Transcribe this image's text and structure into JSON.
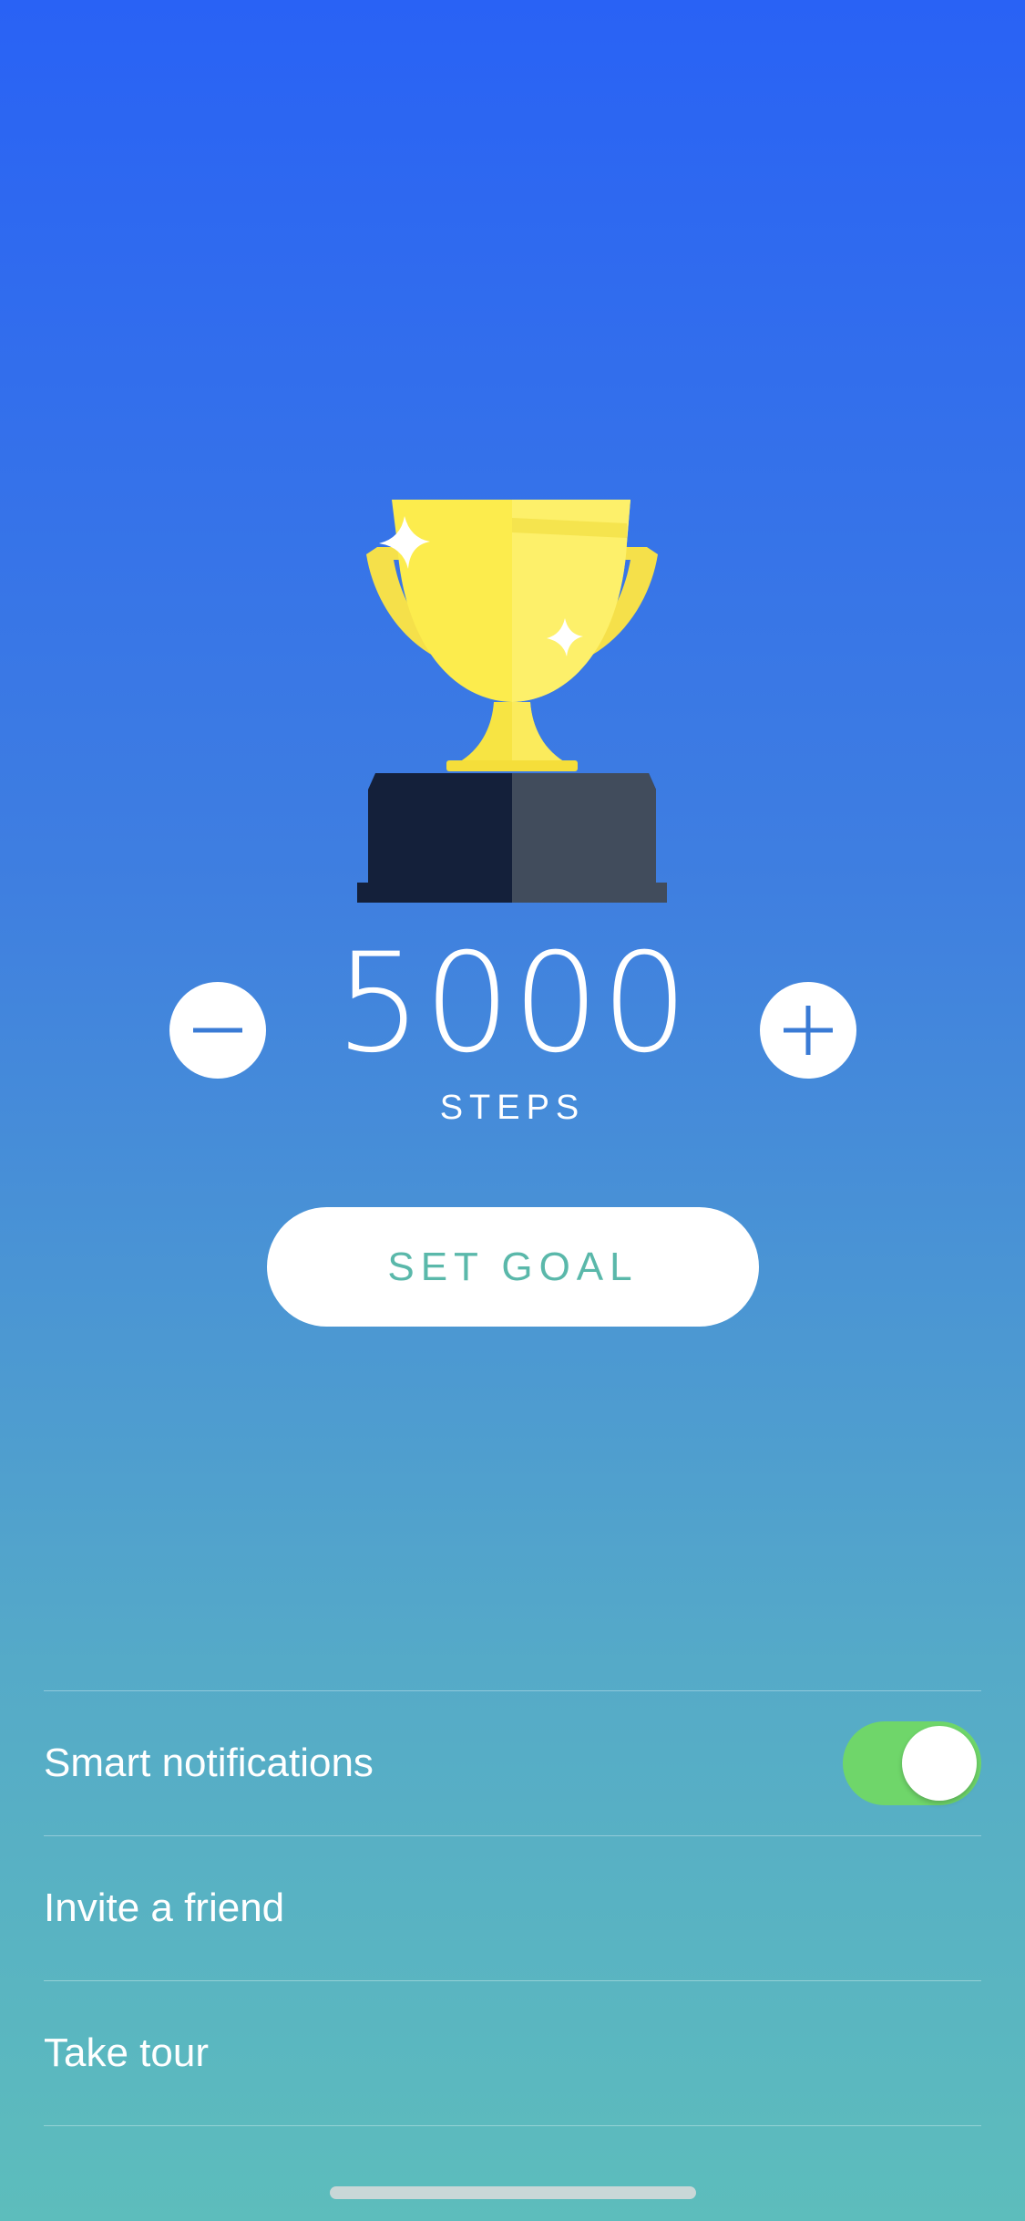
{
  "goal": {
    "value": "5000",
    "unit": "STEPS",
    "decrease_icon": "minus-icon",
    "increase_icon": "plus-icon"
  },
  "trophy_icon": "trophy-icon",
  "set_goal_label": "SET GOAL",
  "settings": {
    "items": [
      {
        "label": "Smart notifications",
        "toggle_on": true
      },
      {
        "label": "Invite a friend"
      },
      {
        "label": "Take tour"
      }
    ]
  },
  "colors": {
    "gradient_top": "#2962f5",
    "gradient_bottom": "#5dbdbc",
    "accent_text": "#5ab8aa",
    "toggle_on": "#6fd66a",
    "stepper_icon": "#3a7bd5"
  }
}
